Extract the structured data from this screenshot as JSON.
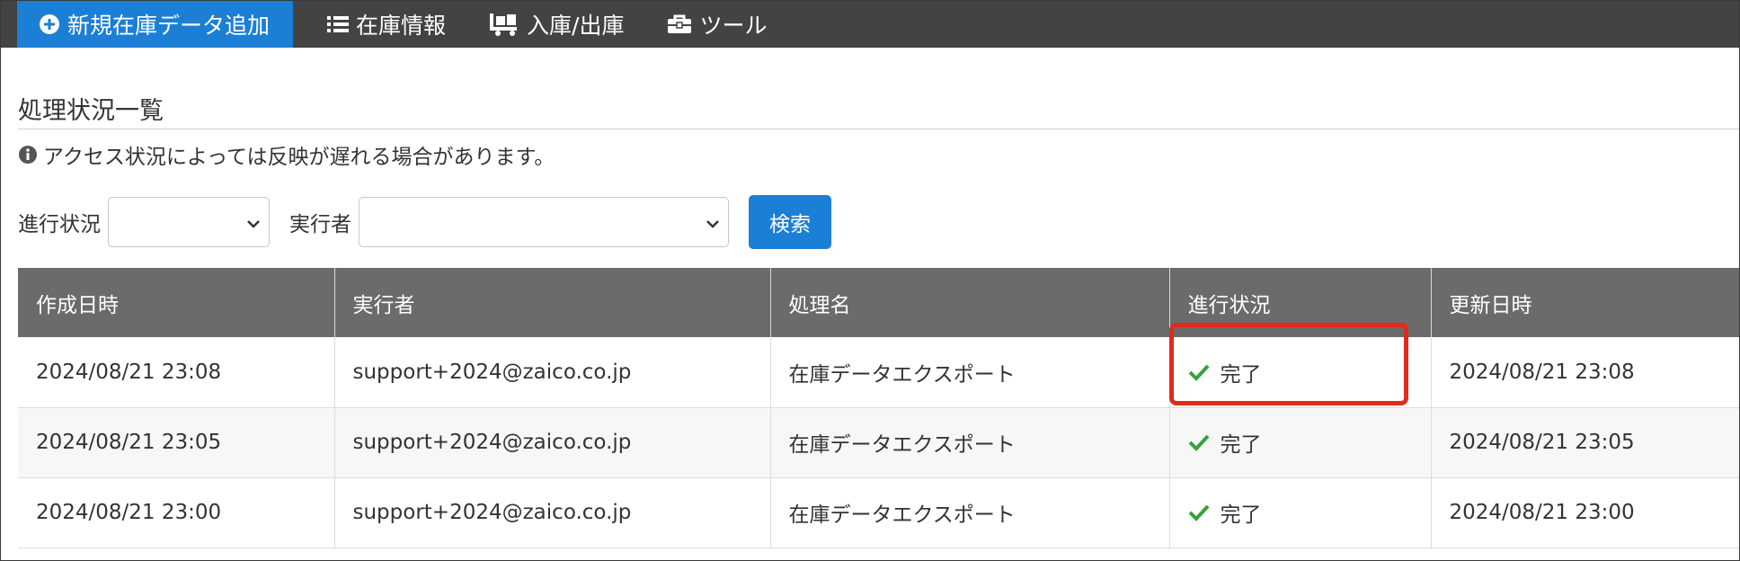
{
  "nav": {
    "items": [
      {
        "label": "新規在庫データ追加",
        "icon": "plus-circle-icon",
        "active": true
      },
      {
        "label": "在庫情報",
        "icon": "list-icon",
        "active": false
      },
      {
        "label": "入庫/出庫",
        "icon": "cart-icon",
        "active": false
      },
      {
        "label": "ツール",
        "icon": "toolbox-icon",
        "active": false
      }
    ]
  },
  "page": {
    "title": "処理状況一覧",
    "notice": "アクセス状況によっては反映が遅れる場合があります。"
  },
  "filters": {
    "status_label": "進行状況",
    "status_value": "",
    "executor_label": "実行者",
    "executor_value": "",
    "search_label": "検索"
  },
  "table": {
    "headers": [
      "作成日時",
      "実行者",
      "処理名",
      "進行状況",
      "更新日時"
    ],
    "rows": [
      {
        "created": "2024/08/21 23:08",
        "executor": "support+2024@zaico.co.jp",
        "process": "在庫データエクスポート",
        "status": "完了",
        "updated": "2024/08/21 23:08"
      },
      {
        "created": "2024/08/21 23:05",
        "executor": "support+2024@zaico.co.jp",
        "process": "在庫データエクスポート",
        "status": "完了",
        "updated": "2024/08/21 23:05"
      },
      {
        "created": "2024/08/21 23:00",
        "executor": "support+2024@zaico.co.jp",
        "process": "在庫データエクスポート",
        "status": "完了",
        "updated": "2024/08/21 23:00"
      }
    ]
  },
  "colors": {
    "navbar": "#434343",
    "accent": "#1b7fd6",
    "table_header": "#6b6b6b",
    "status_ok": "#3aa13a",
    "highlight": "#e02b20"
  }
}
